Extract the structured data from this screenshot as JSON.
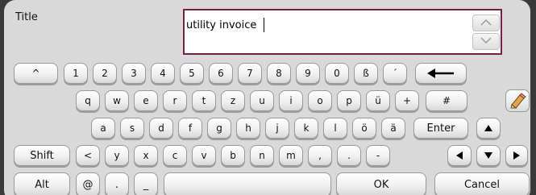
{
  "form": {
    "title_label": "Title",
    "title_value": "utility invoice"
  },
  "icons": {
    "scroll_up": "chevron-up-icon",
    "scroll_down": "chevron-down-icon",
    "backspace": "backspace-arrow-icon",
    "edit": "pencil-eraser-icon",
    "cursor_up": "triangle-up-icon",
    "cursor_down": "triangle-down-icon",
    "cursor_left": "triangle-left-icon",
    "cursor_right": "triangle-right-icon"
  },
  "keyboard": {
    "row1": [
      "^",
      "1",
      "2",
      "3",
      "4",
      "5",
      "6",
      "7",
      "8",
      "9",
      "0",
      "ß",
      "´"
    ],
    "row2": [
      "q",
      "w",
      "e",
      "r",
      "t",
      "z",
      "u",
      "i",
      "o",
      "p",
      "ü",
      "+",
      "#"
    ],
    "row3": [
      "a",
      "s",
      "d",
      "f",
      "g",
      "h",
      "j",
      "k",
      "l",
      "ö",
      "ä"
    ],
    "enter": "Enter",
    "shift": "Shift",
    "row4": [
      "<",
      "y",
      "x",
      "c",
      "v",
      "b",
      "n",
      "m",
      ",",
      ".",
      "-"
    ],
    "alt": "Alt",
    "row5": [
      "@",
      ".",
      "_"
    ],
    "space": ""
  },
  "actions": {
    "ok": "OK",
    "cancel": "Cancel"
  },
  "colors": {
    "field_border": "#7a1e48",
    "panel": "#d9d9d9",
    "background": "#3a3a3a"
  }
}
